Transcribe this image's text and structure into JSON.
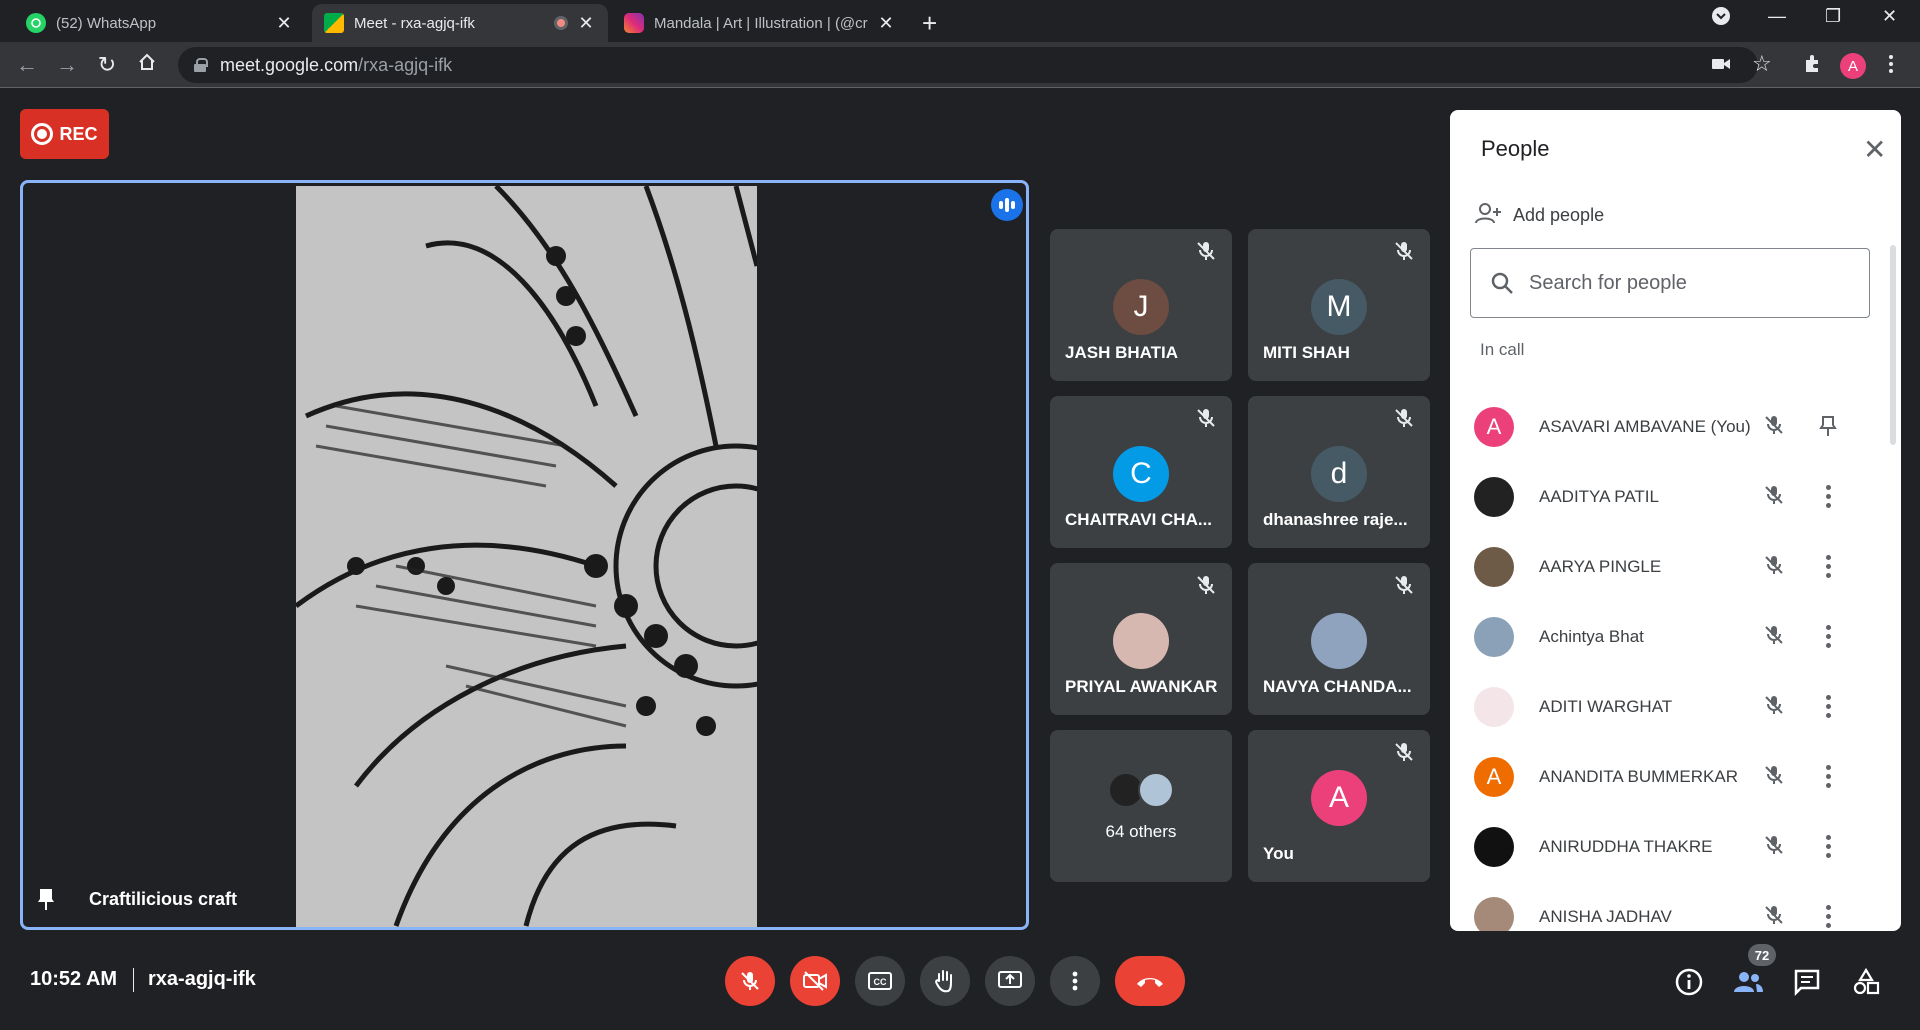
{
  "browser": {
    "tabs": [
      {
        "title": "(52) WhatsApp",
        "badge": "52",
        "favicon_color": "#25d366"
      },
      {
        "title": "Meet - rxa-agjq-ifk",
        "favicon_color": "#00ac47"
      },
      {
        "title": "Mandala | Art | Illustration | (@cr",
        "favicon_color": "#e1306c"
      }
    ],
    "url_host": "meet.google.com",
    "url_path": "/rxa-agjq-ifk",
    "profile_initial": "A"
  },
  "rec_label": "REC",
  "main": {
    "presenter_name": "Craftilicious craft"
  },
  "tiles": [
    {
      "initial": "J",
      "name": "JASH BHATIA",
      "color": "#6d4c41",
      "muted": true
    },
    {
      "initial": "M",
      "name": "MITI SHAH",
      "color": "#455a64",
      "muted": true
    },
    {
      "initial": "C",
      "name": "CHAITRAVI CHA...",
      "color": "#039be5",
      "muted": true
    },
    {
      "initial": "d",
      "name": "dhanashree raje...",
      "color": "#455a64",
      "muted": true
    },
    {
      "initial": "",
      "name": "PRIYAL AWANKAR",
      "color": "#d7b8b0",
      "muted": true
    },
    {
      "initial": "",
      "name": "NAVYA CHANDA...",
      "color": "#8fa3bf",
      "muted": true
    },
    {
      "initial": "",
      "name": "64 others",
      "color": "#3c4043",
      "muted": false
    },
    {
      "initial": "A",
      "name": "You",
      "color": "#ec407a",
      "muted": true
    }
  ],
  "people_panel": {
    "title": "People",
    "add_people": "Add people",
    "search_placeholder": "Search for people",
    "section_label": "In call",
    "people": [
      {
        "initial": "A",
        "name": "ASAVARI AMBAVANE (You)",
        "color": "#ec407a"
      },
      {
        "initial": "",
        "name": "AADITYA PATIL",
        "color": "#222222"
      },
      {
        "initial": "",
        "name": "AARYA PINGLE",
        "color": "#6d5a47"
      },
      {
        "initial": "",
        "name": "Achintya Bhat",
        "color": "#8aa1b8"
      },
      {
        "initial": "",
        "name": "ADITI WARGHAT",
        "color": "#f3e5e8"
      },
      {
        "initial": "A",
        "name": "ANANDITA BUMMERKAR",
        "color": "#ef6c00"
      },
      {
        "initial": "",
        "name": "ANIRUDDHA THAKRE",
        "color": "#111111"
      },
      {
        "initial": "",
        "name": "ANISHA JADHAV",
        "color": "#a58a7a"
      }
    ]
  },
  "bottom": {
    "time": "10:52 AM",
    "meeting_code": "rxa-agjq-ifk",
    "people_count": "72"
  },
  "colors": {
    "accent_blue": "#8ab4f8",
    "danger_red": "#ea4335",
    "background": "#202124",
    "tile": "#3c4043"
  }
}
